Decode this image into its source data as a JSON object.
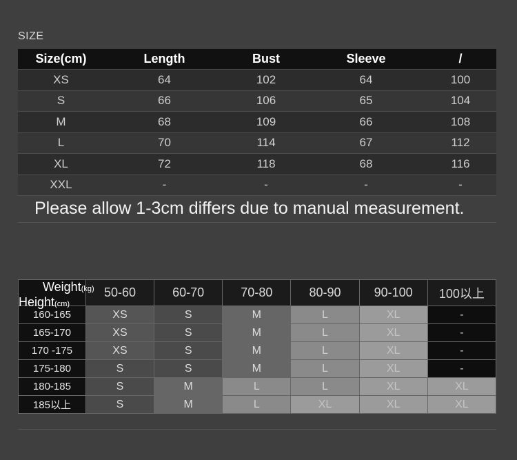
{
  "section_label": "SIZE",
  "size_table": {
    "headers": [
      "Size(cm)",
      "Length",
      "Bust",
      "Sleeve",
      "/"
    ],
    "rows": [
      [
        "XS",
        "64",
        "102",
        "64",
        "100"
      ],
      [
        "S",
        "66",
        "106",
        "65",
        "104"
      ],
      [
        "M",
        "68",
        "109",
        "66",
        "108"
      ],
      [
        "L",
        "70",
        "114",
        "67",
        "112"
      ],
      [
        "XL",
        "72",
        "118",
        "68",
        "116"
      ],
      [
        "XXL",
        "-",
        "-",
        "-",
        "-"
      ]
    ]
  },
  "note": "Please allow 1-3cm differs due to manual measurement.",
  "weight_height_grid": {
    "corner": {
      "weight_label": "Weight",
      "weight_unit": "(kg)",
      "height_label": "Height",
      "height_unit": "(cm)"
    },
    "weight_columns": [
      "50-60",
      "60-70",
      "70-80",
      "80-90",
      "90-100",
      "100以上"
    ],
    "rows": [
      {
        "height": "160-165",
        "sizes": [
          "XS",
          "S",
          "M",
          "L",
          "XL",
          "-"
        ]
      },
      {
        "height": "165-170",
        "sizes": [
          "XS",
          "S",
          "M",
          "L",
          "XL",
          "-"
        ]
      },
      {
        "height": "170 -175",
        "sizes": [
          "XS",
          "S",
          "M",
          "L",
          "XL",
          "-"
        ]
      },
      {
        "height": "175-180",
        "sizes": [
          "S",
          "S",
          "M",
          "L",
          "XL",
          "-"
        ]
      },
      {
        "height": "180-185",
        "sizes": [
          "S",
          "M",
          "L",
          "L",
          "XL",
          "XL"
        ]
      },
      {
        "height": "185以上",
        "sizes": [
          "S",
          "M",
          "L",
          "XL",
          "XL",
          "XL"
        ]
      }
    ]
  }
}
